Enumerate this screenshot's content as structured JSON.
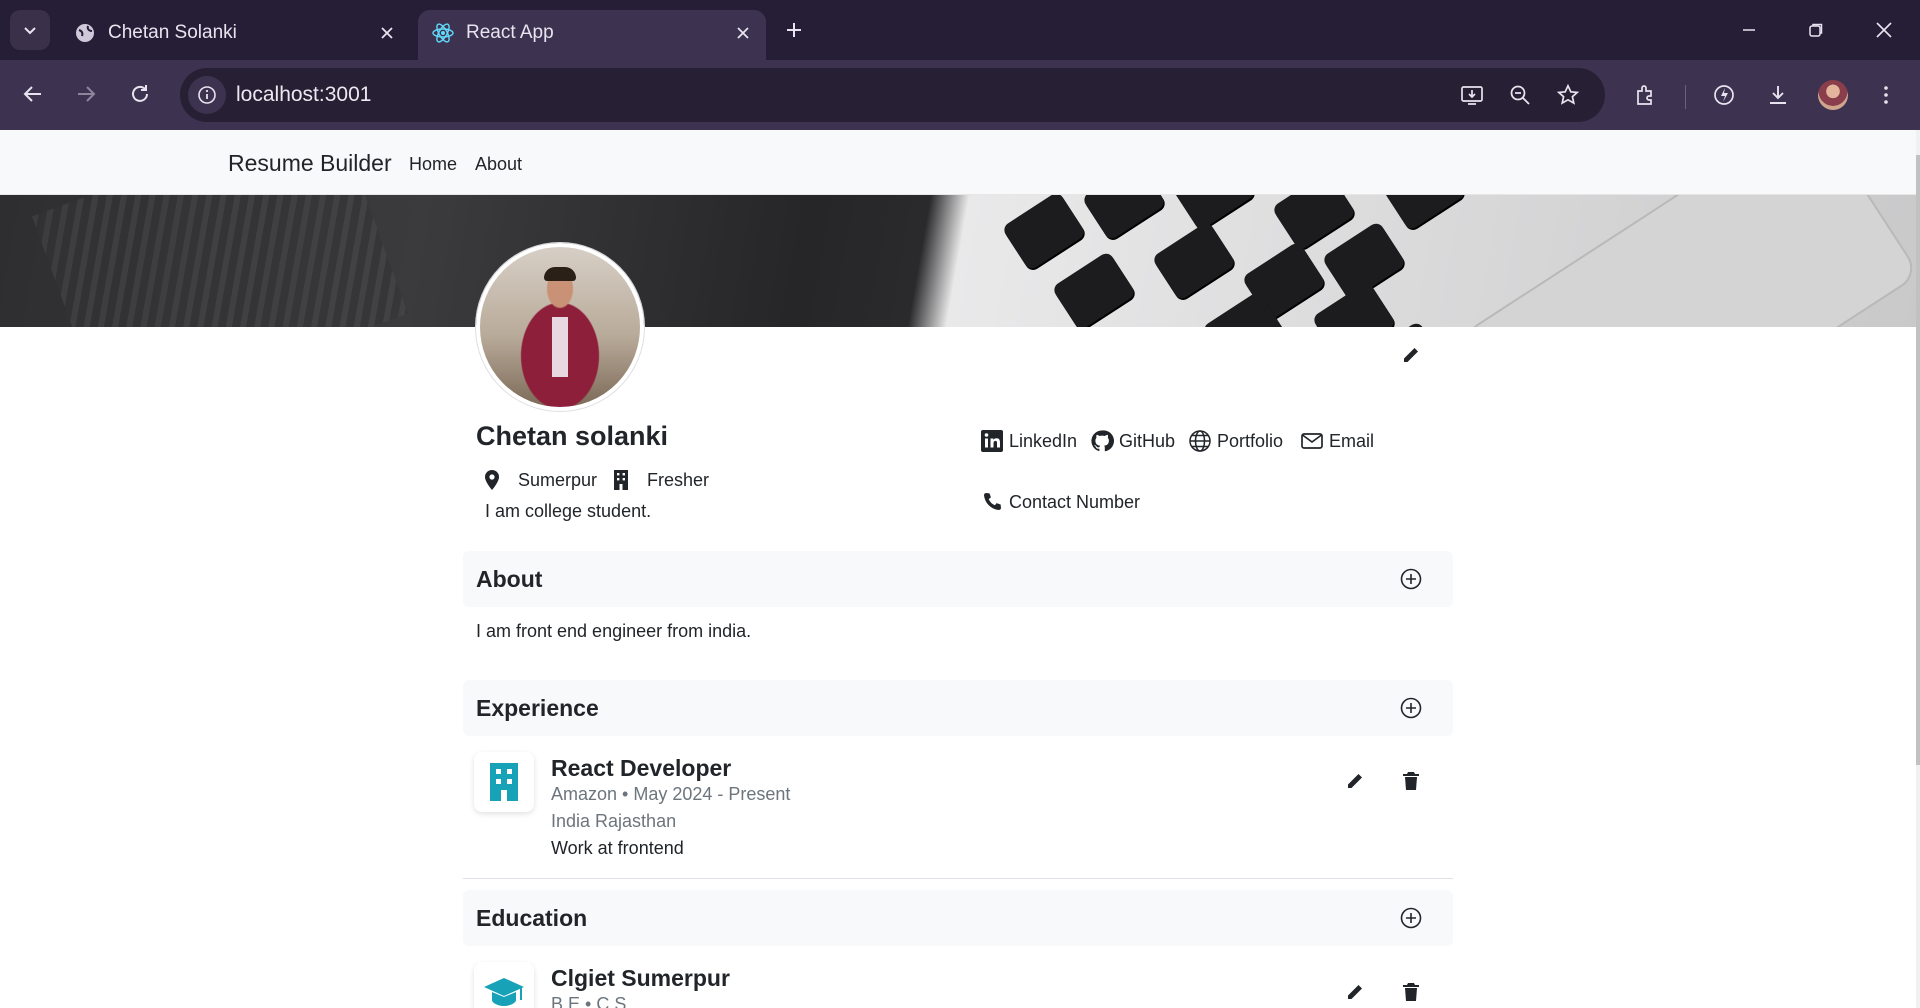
{
  "browser": {
    "tabs": [
      {
        "title": "Chetan Solanki",
        "icon": "globe-icon",
        "active": false
      },
      {
        "title": "React App",
        "icon": "react-icon",
        "active": true
      }
    ],
    "url": "localhost:3001"
  },
  "navbar": {
    "brand": "Resume Builder",
    "links": [
      "Home",
      "About"
    ]
  },
  "profile": {
    "name": "Chetan solanki",
    "location": "Sumerpur",
    "status": "Fresher",
    "bio": "I am college student.",
    "links": {
      "linkedin": "LinkedIn",
      "github": "GitHub",
      "portfolio": "Portfolio",
      "email": "Email",
      "phone": "Contact Number"
    }
  },
  "sections": {
    "about": {
      "title": "About",
      "text": "I am front end engineer from india."
    },
    "experience": {
      "title": "Experience",
      "items": [
        {
          "title": "React Developer",
          "subtitle": "Amazon • May 2024 - Present",
          "location": "India Rajasthan",
          "description": "Work at frontend"
        }
      ]
    },
    "education": {
      "title": "Education",
      "items": [
        {
          "title": "Clgiet Sumerpur",
          "subtitle": "B.E • C.S"
        }
      ]
    }
  },
  "colors": {
    "accent": "#17a2b8",
    "browser_frame": "#261d36",
    "browser_toolbar": "#3d3350",
    "navbar_bg": "#f8f9fa"
  }
}
